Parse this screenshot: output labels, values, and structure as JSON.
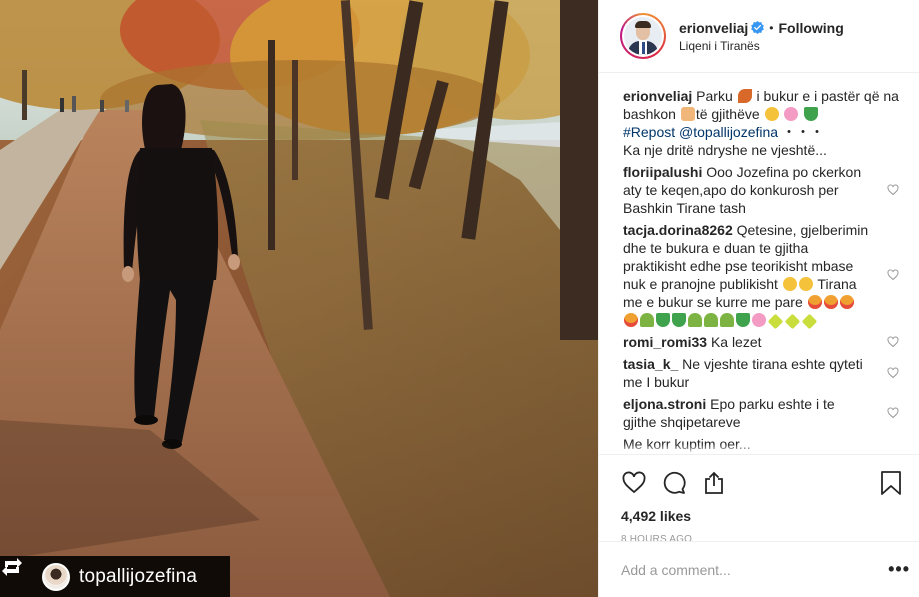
{
  "photo": {
    "repost_username": "topallijozefina",
    "repost_icon": "repost-icon"
  },
  "header": {
    "username": "erionveliaj",
    "verified_icon": "verified-badge-icon",
    "separator": "•",
    "follow_status": "Following",
    "location": "Liqeni i Tiranës"
  },
  "caption": {
    "username": "erionveliaj",
    "text_1": "Parku",
    "text_2": "i bukur e i pastër që na bashkon",
    "text_3": "të gjithëve",
    "hashtag_mention": "#Repost @topallijozefina",
    "ellipsis_dots": "・・・",
    "text_4": "Ka nje dritë ndryshe ne vjeshtë..."
  },
  "comments": [
    {
      "username": "floriipalushi",
      "text": "Ooo Jozefina po ckerkon aty te keqen,apo do konkurosh per Bashkin Tirane tash"
    },
    {
      "username": "tacja.dorina8262",
      "text": "Qetesine, gjelberimin dhe te bukura e duan te gjitha praktikisht edhe pse teorikisht mbase nuk e pranojne publikisht",
      "text_2": "Tirana me e bukur se kurre me pare"
    },
    {
      "username": "romi_romi33",
      "text": "Ka lezet"
    },
    {
      "username": "tasia_k_",
      "text": "Ne vjeshte tirana eshte qyteti me I bukur"
    },
    {
      "username": "eljona.stroni",
      "text": "Epo parku eshte i te gjithe shqipetareve"
    },
    {
      "username": "",
      "text": "Me korr kuptim oer..."
    }
  ],
  "actions": {
    "like_icon": "heart-icon",
    "comment_icon": "comment-icon",
    "share_icon": "share-icon",
    "save_icon": "bookmark-icon",
    "likes": "4,492 likes",
    "timestamp": "8 hours ago"
  },
  "add_comment": {
    "placeholder": "Add a comment...",
    "more_label": "•••"
  },
  "colors": {
    "link": "#003569",
    "verified": "#3897f0",
    "muted": "#999999",
    "repost_bar": "#000000"
  }
}
